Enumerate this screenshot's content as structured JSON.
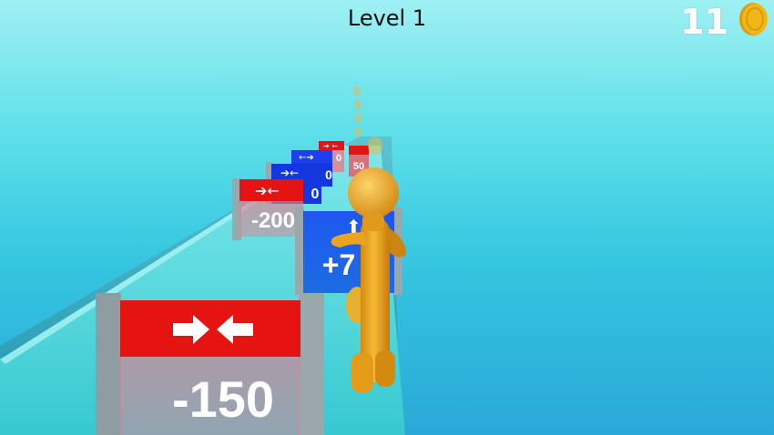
{
  "hud": {
    "level_text": "Level 1",
    "coin_count": "11",
    "coin_icon": "gold-coin-icon"
  },
  "gates": [
    {
      "operation": "subtract",
      "value_text": "-150",
      "color": "#e61313",
      "arrows": "inward"
    },
    {
      "operation": "add",
      "value_text": "+7",
      "color": "#1438e0",
      "arrows": "outward"
    },
    {
      "operation": "subtract",
      "value_text": "-200",
      "color": "#e61313",
      "arrows": "inward"
    },
    {
      "operation": "unknown",
      "value_text": "0",
      "color": "#1438e0",
      "arrows": "inward"
    },
    {
      "operation": "unknown",
      "value_text": "0",
      "color": "#1438e0",
      "arrows": "outward"
    },
    {
      "operation": "unknown",
      "value_text": "0",
      "color": "#e61313",
      "arrows": "inward"
    },
    {
      "operation": "unknown",
      "value_text": "50",
      "color": "#e61313",
      "arrows": "none"
    }
  ],
  "colors": {
    "sky": "#7fe7ee",
    "track": "#3fd2d6",
    "character": "#f0a81e",
    "red_gate": "#e61313",
    "blue_gate": "#1438e0",
    "coin": "#f2b716"
  }
}
